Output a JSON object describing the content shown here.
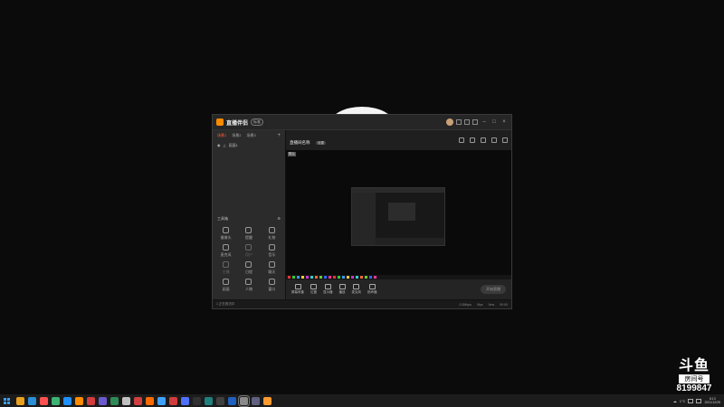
{
  "app": {
    "title": "直播伴侣",
    "version": "标准"
  },
  "left": {
    "tabs": [
      "场景1",
      "场景2",
      "场景3"
    ],
    "scene_row": "画面1",
    "tools_title": "工具箱",
    "tools": [
      {
        "icon": "camera-icon",
        "label": "摄像头"
      },
      {
        "icon": "bell-icon",
        "label": "提醒"
      },
      {
        "icon": "gift-icon",
        "label": "礼物"
      },
      {
        "icon": "mic-icon",
        "label": "麦克风"
      },
      {
        "icon": "user-icon",
        "label": "用户"
      },
      {
        "icon": "music-icon",
        "label": "音乐"
      },
      {
        "icon": "people-icon",
        "label": "主播"
      },
      {
        "icon": "calendar-icon",
        "label": "日程"
      },
      {
        "icon": "chat-icon",
        "label": "聊天"
      },
      {
        "icon": "screen-icon",
        "label": "画面"
      },
      {
        "icon": "person-icon",
        "label": "人物"
      },
      {
        "icon": "window-icon",
        "label": "窗口"
      }
    ]
  },
  "room": {
    "title": "直播间名称",
    "badge": "设置",
    "category": "游戏",
    "meta1": "0",
    "meta2": "0",
    "viewers": "0"
  },
  "preview": {
    "tag": "默认"
  },
  "controls": [
    {
      "icon": "screen-share-icon",
      "label": "屏幕采集"
    },
    {
      "icon": "location-icon",
      "label": "位置"
    },
    {
      "icon": "monitor-icon",
      "label": "显示器"
    },
    {
      "icon": "play-icon",
      "label": "播放"
    },
    {
      "icon": "mic-icon",
      "label": "麦克风"
    },
    {
      "icon": "speaker-icon",
      "label": "扬声器"
    }
  ],
  "start_button": "开始直播",
  "status": {
    "msg": "1 正在推流中",
    "s1": "0.0Mbps",
    "s2": "0fps",
    "s3": "0ms",
    "s4": "00:00"
  },
  "watermark": {
    "logo": "斗鱼",
    "sub": "房间号",
    "number": "8199847"
  },
  "taskbar": {
    "apps": [
      "#e8a020",
      "#2a8fd8",
      "#ff5050",
      "#3cb371",
      "#1e90ff",
      "#ff8c00",
      "#d23c3c",
      "#6a5acd",
      "#2e8b57",
      "#c0c0c0",
      "#d04040",
      "#ff6a00",
      "#40a0ff",
      "#d23c3c",
      "#5070ff",
      "#303030",
      "#208080",
      "#404040",
      "#2060c0",
      "#8a8a8a",
      "#606080",
      "#ff9a30"
    ],
    "temp": "1°C",
    "time": "8:13",
    "date": "2021/12/25"
  }
}
